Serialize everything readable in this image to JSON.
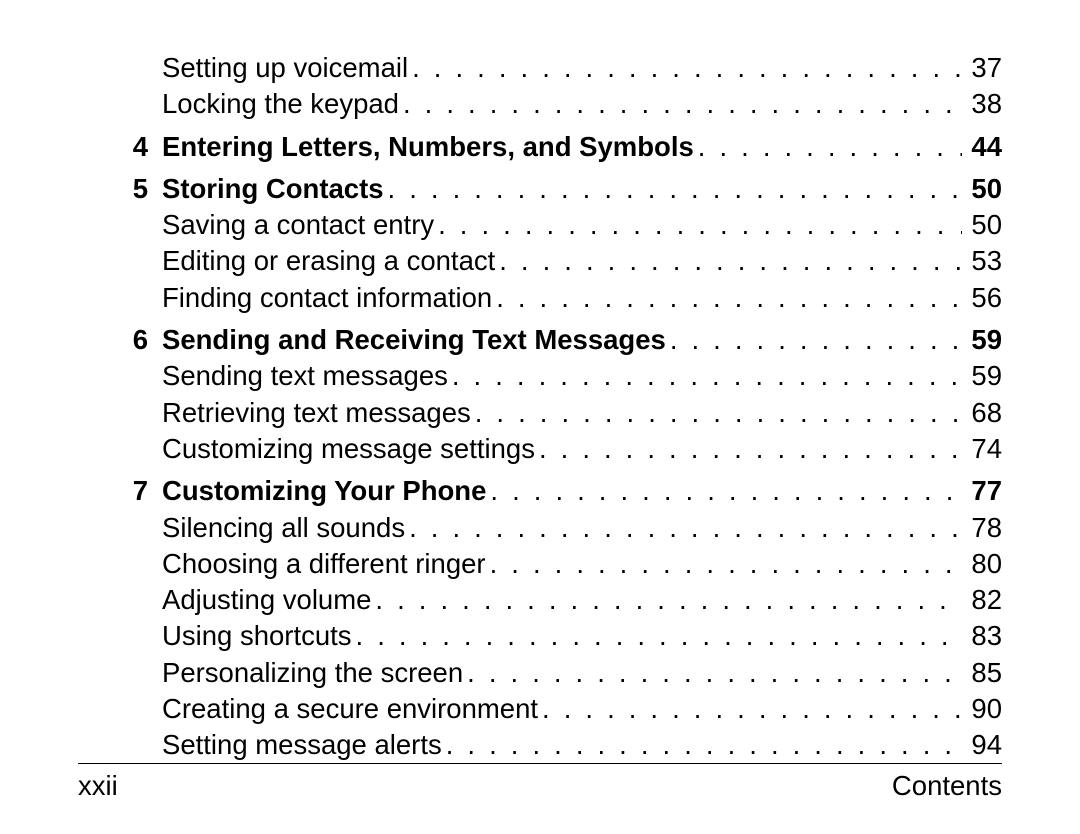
{
  "footer": {
    "page_label": "xxii",
    "section_label": "Contents"
  },
  "entries": [
    {
      "kind": "sub",
      "num": "",
      "title": "Setting up voicemail",
      "page": "37"
    },
    {
      "kind": "sub",
      "num": "",
      "title": "Locking the keypad",
      "page": "38"
    },
    {
      "kind": "chapter",
      "num": "4",
      "title": "Entering Letters, Numbers, and Symbols",
      "page": "44"
    },
    {
      "kind": "chapter",
      "num": "5",
      "title": "Storing Contacts",
      "page": "50"
    },
    {
      "kind": "sub",
      "num": "",
      "title": "Saving a contact entry",
      "page": "50"
    },
    {
      "kind": "sub",
      "num": "",
      "title": "Editing or erasing a contact",
      "page": "53"
    },
    {
      "kind": "sub",
      "num": "",
      "title": "Finding contact information",
      "page": "56"
    },
    {
      "kind": "chapter",
      "num": "6",
      "title": "Sending and Receiving Text Messages",
      "page": "59"
    },
    {
      "kind": "sub",
      "num": "",
      "title": "Sending text messages",
      "page": "59"
    },
    {
      "kind": "sub",
      "num": "",
      "title": "Retrieving text messages",
      "page": "68"
    },
    {
      "kind": "sub",
      "num": "",
      "title": "Customizing message settings",
      "page": "74"
    },
    {
      "kind": "chapter",
      "num": "7",
      "title": "Customizing Your Phone",
      "page": "77"
    },
    {
      "kind": "sub",
      "num": "",
      "title": "Silencing all sounds",
      "page": "78"
    },
    {
      "kind": "sub",
      "num": "",
      "title": "Choosing a different ringer",
      "page": "80"
    },
    {
      "kind": "sub",
      "num": "",
      "title": "Adjusting volume",
      "page": "82"
    },
    {
      "kind": "sub",
      "num": "",
      "title": "Using shortcuts",
      "page": "83"
    },
    {
      "kind": "sub",
      "num": "",
      "title": "Personalizing the screen",
      "page": "85"
    },
    {
      "kind": "sub",
      "num": "",
      "title": "Creating a secure environment",
      "page": "90"
    },
    {
      "kind": "sub",
      "num": "",
      "title": "Setting message alerts",
      "page": "94"
    }
  ]
}
